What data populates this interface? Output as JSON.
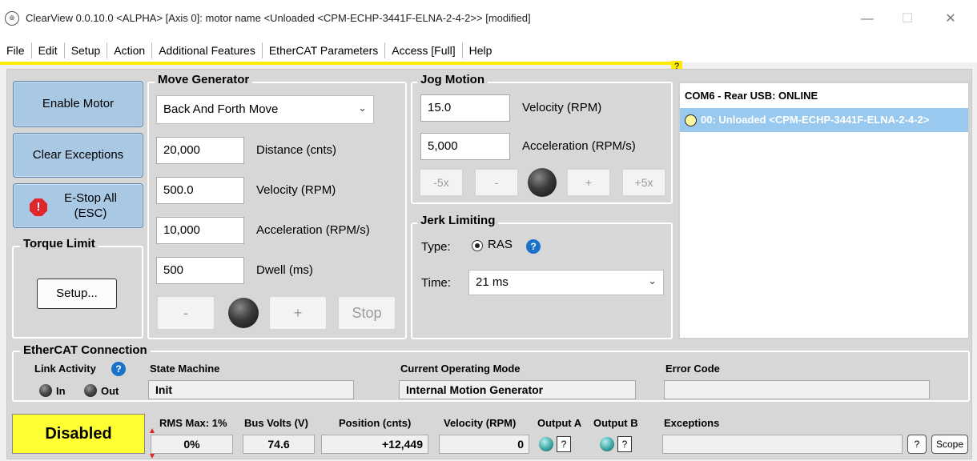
{
  "window": {
    "icon_glyph": "⊕",
    "title": "ClearView 0.0.10.0 <ALPHA> [Axis 0]: motor name <Unloaded <CPM-ECHP-3441F-ELNA-2-4-2>> [modified]",
    "minimize": "—",
    "maximize": "☐",
    "close": "✕"
  },
  "menu": [
    "File",
    "Edit",
    "Setup",
    "Action",
    "Additional Features",
    "EtherCAT Parameters",
    "Access [Full]",
    "Help"
  ],
  "menu_help_badge": "?",
  "left_panel": {
    "enable_motor": "Enable Motor",
    "clear_exceptions": "Clear Exceptions",
    "estop": "E-Stop All (ESC)",
    "estop_icon": "!",
    "torque_title": "Torque Limit",
    "torque_setup": "Setup..."
  },
  "move_generator": {
    "title": "Move Generator",
    "mode": "Back And Forth Move",
    "mode_arrow": "⌄",
    "distance_value": "20,000",
    "distance_label": "Distance (cnts)",
    "velocity_value": "500.0",
    "velocity_label": "Velocity (RPM)",
    "accel_value": "10,000",
    "accel_label": "Acceleration (RPM/s)",
    "dwell_value": "500",
    "dwell_label": "Dwell (ms)",
    "minus": "-",
    "plus": "+",
    "stop": "Stop"
  },
  "jog": {
    "title": "Jog Motion",
    "velocity_value": "15.0",
    "velocity_label": "Velocity (RPM)",
    "accel_value": "5,000",
    "accel_label": "Acceleration (RPM/s)",
    "m5": "-5x",
    "m": "-",
    "p": "+",
    "p5": "+5x"
  },
  "jerk": {
    "title": "Jerk Limiting",
    "type_label": "Type:",
    "type_value": "RAS",
    "info": "?",
    "time_label": "Time:",
    "time_value": "21 ms",
    "time_arrow": "⌄"
  },
  "tree": {
    "port": "COM6 - Rear USB: ONLINE",
    "node": "00: Unloaded <CPM-ECHP-3441F-ELNA-2-4-2>"
  },
  "ethercat": {
    "title": "EtherCAT Connection",
    "link_label": "Link Activity",
    "info": "?",
    "in_label": "In",
    "out_label": "Out",
    "state_label": "State Machine",
    "state_value": "Init",
    "mode_label": "Current Operating Mode",
    "mode_value": "Internal Motion Generator",
    "error_label": "Error Code",
    "error_value": ""
  },
  "status": {
    "state": "Disabled",
    "rms_label": "RMS Max: 1%",
    "rms_value": "0%",
    "bus_label": "Bus Volts (V)",
    "bus_value": "74.6",
    "pos_label": "Position (cnts)",
    "pos_value": "+12,449",
    "vel_label": "Velocity (RPM)",
    "vel_value": "0",
    "outa_label": "Output A",
    "outb_label": "Output B",
    "q": "?",
    "exc_label": "Exceptions",
    "exc_value": "",
    "help": "?",
    "scope": "Scope"
  },
  "colors": {
    "accent_yellow": "#ffeb00",
    "selection_blue": "#99c9ee",
    "button_blue": "#a8c8e4",
    "estop_red": "#e0252b"
  }
}
